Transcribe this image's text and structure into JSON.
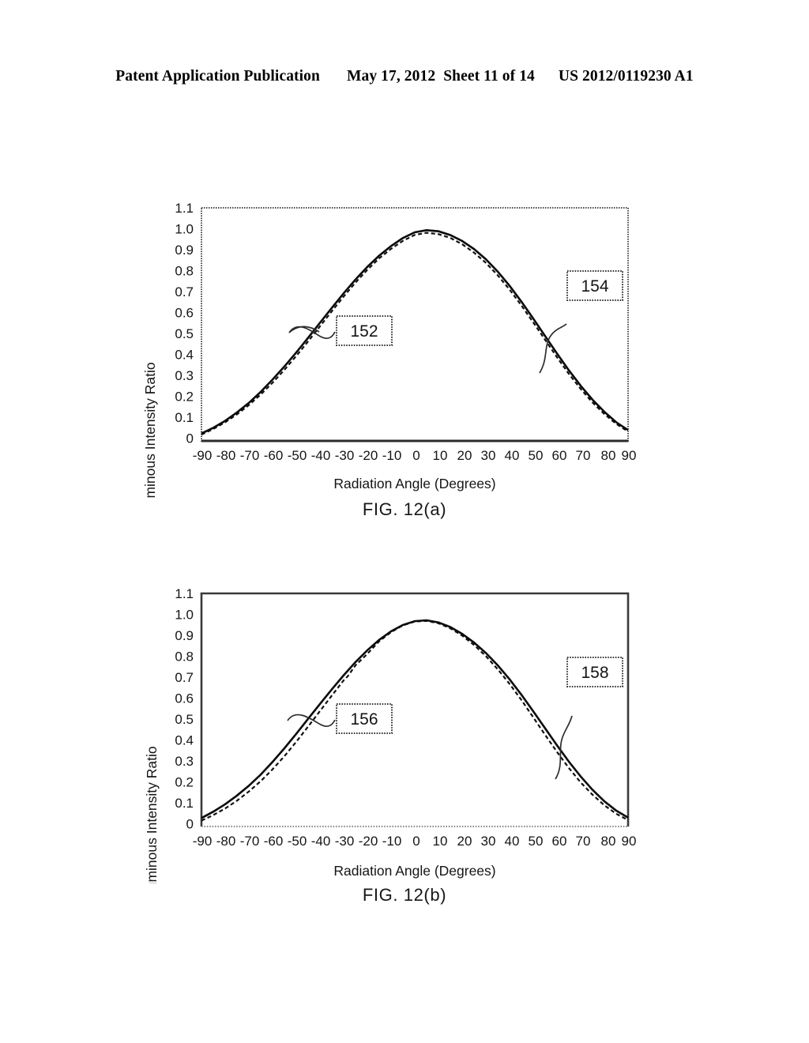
{
  "header": {
    "publication": "Patent Application Publication",
    "date": "May 17, 2012",
    "sheet": "Sheet 11 of 14",
    "docket": "US 2012/0119230 A1"
  },
  "figures": [
    {
      "id": "fig-12a",
      "caption": "FIG. 12(a)",
      "callouts": [
        {
          "label": "152"
        },
        {
          "label": "154"
        }
      ]
    },
    {
      "id": "fig-12b",
      "caption": "FIG. 12(b)",
      "callouts": [
        {
          "label": "156"
        },
        {
          "label": "158"
        }
      ]
    }
  ],
  "chart_data": [
    {
      "type": "line",
      "title": "FIG. 12(a)",
      "xlabel": "Radiation Angle (Degrees)",
      "ylabel": "Luminous Intensity Ratio",
      "xlim": [
        -90,
        90
      ],
      "ylim": [
        0,
        1.1
      ],
      "grid": false,
      "legend_position": "none",
      "xticks": [
        -90,
        -80,
        -70,
        -60,
        -50,
        -40,
        -30,
        -20,
        -10,
        0,
        10,
        20,
        30,
        40,
        50,
        60,
        70,
        80,
        90
      ],
      "xtick_labels": [
        "-90",
        "-80",
        "-70",
        "-60",
        "-50",
        "-40",
        "-30",
        "-20",
        "-10",
        "0",
        "10",
        "20",
        "30",
        "40",
        "50",
        "60",
        "70",
        "80",
        "90"
      ],
      "yticks": [
        0,
        0.1,
        0.2,
        0.3,
        0.4,
        0.5,
        0.6,
        0.7,
        0.8,
        0.9,
        1.0,
        1.1
      ],
      "ytick_labels": [
        "0",
        "0.1",
        "0.2",
        "0.3",
        "0.4",
        "0.5",
        "0.6",
        "0.7",
        "0.8",
        "0.9",
        "1.0",
        "1.1"
      ],
      "x": [
        -90,
        -85,
        -80,
        -75,
        -70,
        -65,
        -60,
        -55,
        -50,
        -45,
        -40,
        -35,
        -30,
        -25,
        -20,
        -15,
        -10,
        -5,
        0,
        5,
        10,
        15,
        20,
        25,
        30,
        35,
        40,
        45,
        50,
        55,
        60,
        65,
        70,
        75,
        80,
        85,
        90
      ],
      "series": [
        {
          "name": "solid-curve",
          "style": "solid",
          "values": [
            0.035,
            0.062,
            0.095,
            0.135,
            0.18,
            0.232,
            0.29,
            0.352,
            0.418,
            0.487,
            0.558,
            0.628,
            0.697,
            0.762,
            0.822,
            0.875,
            0.92,
            0.958,
            0.985,
            0.995,
            0.99,
            0.972,
            0.944,
            0.906,
            0.858,
            0.8,
            0.733,
            0.658,
            0.578,
            0.496,
            0.414,
            0.335,
            0.262,
            0.196,
            0.139,
            0.09,
            0.052
          ]
        },
        {
          "name": "dashed-curve",
          "style": "dashed",
          "values": [
            0.03,
            0.056,
            0.088,
            0.126,
            0.17,
            0.221,
            0.278,
            0.34,
            0.406,
            0.476,
            0.548,
            0.62,
            0.69,
            0.756,
            0.817,
            0.871,
            0.916,
            0.954,
            0.982,
            0.992,
            0.986,
            0.968,
            0.938,
            0.898,
            0.849,
            0.79,
            0.722,
            0.646,
            0.565,
            0.482,
            0.399,
            0.32,
            0.248,
            0.183,
            0.128,
            0.081,
            0.045
          ]
        }
      ],
      "annotations": [
        {
          "label": "152",
          "points_to_x": -52,
          "points_to_y": 0.47
        },
        {
          "label": "154",
          "points_to_x": 57,
          "points_to_y": 0.44
        }
      ]
    },
    {
      "type": "line",
      "title": "FIG. 12(b)",
      "xlabel": "Radiation Angle (Degrees)",
      "ylabel": "Luminous Intensity Ratio",
      "xlim": [
        -90,
        90
      ],
      "ylim": [
        0,
        1.1
      ],
      "grid": false,
      "legend_position": "none",
      "xticks": [
        -90,
        -80,
        -70,
        -60,
        -50,
        -40,
        -30,
        -20,
        -10,
        0,
        10,
        20,
        30,
        40,
        50,
        60,
        70,
        80,
        90
      ],
      "xtick_labels": [
        "-90",
        "-80",
        "-70",
        "-60",
        "-50",
        "-40",
        "-30",
        "-20",
        "-10",
        "0",
        "10",
        "20",
        "30",
        "40",
        "50",
        "60",
        "70",
        "80",
        "90"
      ],
      "yticks": [
        0,
        0.1,
        0.2,
        0.3,
        0.4,
        0.5,
        0.6,
        0.7,
        0.8,
        0.9,
        1.0,
        1.1
      ],
      "ytick_labels": [
        "0",
        "0.1",
        "0.2",
        "0.3",
        "0.4",
        "0.5",
        "0.6",
        "0.7",
        "0.8",
        "0.9",
        "1.0",
        "1.1"
      ],
      "x": [
        -90,
        -85,
        -80,
        -75,
        -70,
        -65,
        -60,
        -55,
        -50,
        -45,
        -40,
        -35,
        -30,
        -25,
        -20,
        -15,
        -10,
        -5,
        0,
        5,
        10,
        15,
        20,
        25,
        30,
        35,
        40,
        45,
        50,
        55,
        60,
        65,
        70,
        75,
        80,
        85,
        90
      ],
      "series": [
        {
          "name": "solid-curve",
          "style": "solid",
          "values": [
            0.04,
            0.07,
            0.105,
            0.146,
            0.192,
            0.245,
            0.305,
            0.369,
            0.437,
            0.508,
            0.578,
            0.647,
            0.713,
            0.775,
            0.831,
            0.88,
            0.92,
            0.95,
            0.968,
            0.972,
            0.962,
            0.94,
            0.908,
            0.867,
            0.818,
            0.76,
            0.694,
            0.621,
            0.543,
            0.463,
            0.383,
            0.306,
            0.236,
            0.173,
            0.119,
            0.075,
            0.042
          ]
        },
        {
          "name": "dashed-curve",
          "style": "dashed",
          "values": [
            0.028,
            0.054,
            0.085,
            0.122,
            0.165,
            0.214,
            0.27,
            0.332,
            0.4,
            0.472,
            0.545,
            0.618,
            0.69,
            0.757,
            0.818,
            0.872,
            0.915,
            0.947,
            0.965,
            0.968,
            0.957,
            0.933,
            0.899,
            0.855,
            0.802,
            0.74,
            0.671,
            0.595,
            0.515,
            0.433,
            0.353,
            0.277,
            0.209,
            0.15,
            0.1,
            0.06,
            0.03
          ]
        }
      ],
      "annotations": [
        {
          "label": "156",
          "points_to_x": -52,
          "points_to_y": 0.45
        },
        {
          "label": "158",
          "points_to_x": 60,
          "points_to_y": 0.3
        }
      ]
    }
  ]
}
